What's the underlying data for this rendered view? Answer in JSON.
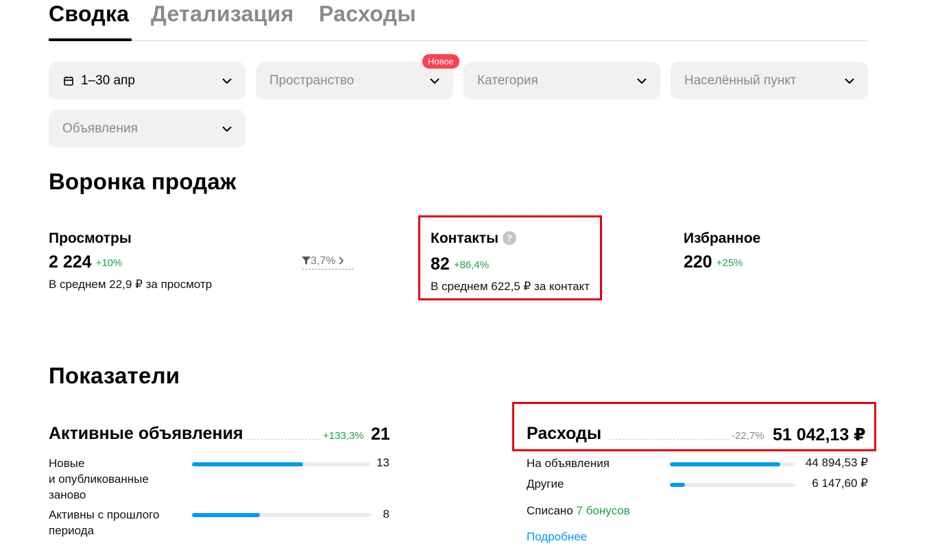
{
  "tabs": [
    {
      "label": "Сводка",
      "active": true
    },
    {
      "label": "Детализация",
      "active": false
    },
    {
      "label": "Расходы",
      "active": false
    }
  ],
  "filters": {
    "date": "1–30 апр",
    "space": "Пространство",
    "space_badge": "Новое",
    "category": "Категория",
    "locality": "Населённый пункт",
    "ads": "Объявления"
  },
  "funnel": {
    "title": "Воронка продаж",
    "views": {
      "title": "Просмотры",
      "value": "2 224",
      "delta": "+10%",
      "sub": "В среднем 22,9 ₽ за просмотр"
    },
    "conversion": "3,7%",
    "contacts": {
      "title": "Контакты",
      "help": "?",
      "value": "82",
      "delta": "+86,4%",
      "sub": "В среднем 622,5 ₽ за контакт"
    },
    "favorites": {
      "title": "Избранное",
      "value": "220",
      "delta": "+25%"
    }
  },
  "indicators": {
    "title": "Показатели",
    "active_ads": {
      "title": "Активные объявления",
      "delta": "+133,3%",
      "value": "21",
      "rows": [
        {
          "label_lines": [
            "Новые",
            "и опубликованные",
            "заново"
          ],
          "value": "13",
          "fraction": 0.62
        },
        {
          "label_lines": [
            "Активны с прошлого",
            "периода"
          ],
          "value": "8",
          "fraction": 0.38
        }
      ]
    },
    "expenses": {
      "title": "Расходы",
      "delta": "-22,7%",
      "value": "51 042,13 ₽",
      "rows": [
        {
          "label": "На объявления",
          "value": "44 894,53 ₽",
          "fraction": 0.88
        },
        {
          "label": "Другие",
          "value": "6 147,60 ₽",
          "fraction": 0.12
        }
      ],
      "written_off_prefix": "Списано",
      "written_off_bonus": "7 бонусов",
      "more_link": "Подробнее"
    }
  },
  "colors": {
    "accent": "#0099f7",
    "positive": "#1aa34a",
    "badge": "#ff4053",
    "highlight": "#e60012"
  }
}
